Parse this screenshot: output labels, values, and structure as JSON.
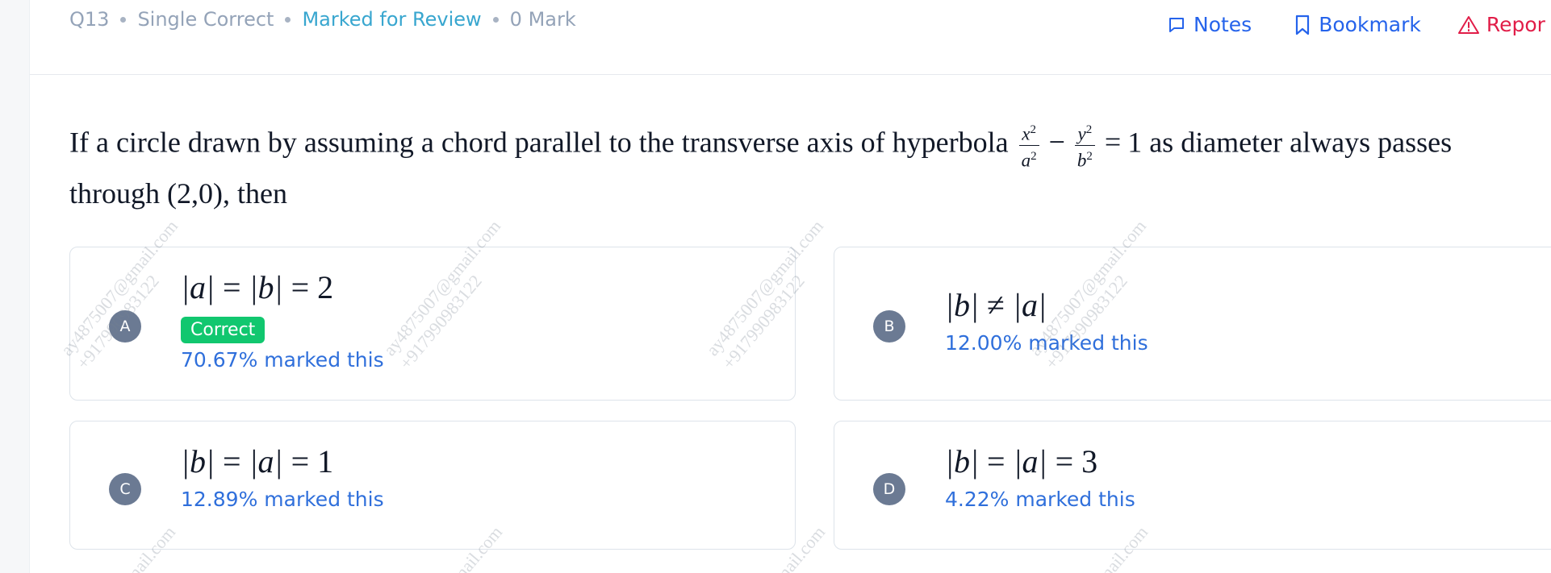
{
  "header": {
    "question_no": "Q13",
    "question_type": "Single Correct",
    "review_status": "Marked for Review",
    "marks": "0 Mark"
  },
  "actions": {
    "notes": "Notes",
    "bookmark": "Bookmark",
    "report": "Repor"
  },
  "question": {
    "text_1": "If a circle drawn by assuming a chord parallel to the transverse axis of hyperbola",
    "text_2": "as diameter always passes through",
    "point": "(2,0)",
    "text_3": ", then"
  },
  "options": [
    {
      "letter": "A",
      "math": [
        "|a|",
        "=",
        "|b|",
        "=",
        "2"
      ],
      "correct_label": "Correct",
      "stat": "70.67% marked this",
      "is_correct": true
    },
    {
      "letter": "B",
      "math": [
        "|b|",
        "≠",
        "|a|"
      ],
      "stat": "12.00% marked this",
      "is_correct": false
    },
    {
      "letter": "C",
      "math": [
        "|b|",
        "=",
        "|a|",
        "=",
        "1"
      ],
      "stat": "12.89% marked this",
      "is_correct": false
    },
    {
      "letter": "D",
      "math": [
        "|b|",
        "=",
        "|a|",
        "=",
        "3"
      ],
      "stat": "4.22% marked this",
      "is_correct": false
    }
  ],
  "watermark": {
    "email": "ay4875007@gmail.com",
    "phone": "+917990983122",
    "email_fragment": "mail.com"
  },
  "colors": {
    "accent_blue": "#2563eb",
    "review_teal": "#38a6cf",
    "report_red": "#e11d48",
    "correct_green": "#11c76f",
    "option_circle": "#6b7a93"
  },
  "icons": {
    "notes": "chat-bubble-icon",
    "bookmark": "bookmark-icon",
    "report": "warning-triangle-icon"
  }
}
